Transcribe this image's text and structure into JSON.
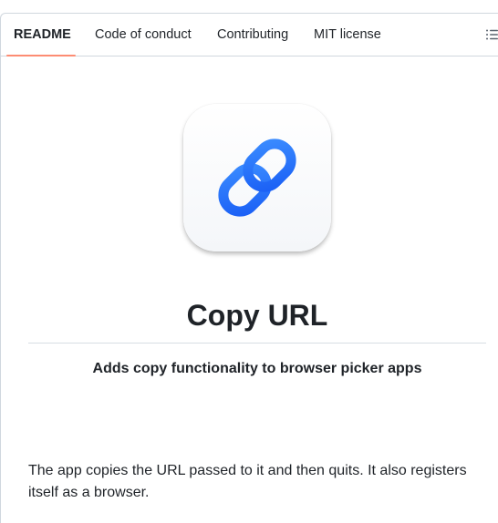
{
  "tabs": [
    {
      "label": "README",
      "active": true
    },
    {
      "label": "Code of conduct",
      "active": false
    },
    {
      "label": "Contributing",
      "active": false
    },
    {
      "label": "MIT license",
      "active": false
    }
  ],
  "outline_icon": "list-unordered-icon",
  "app_icon": "link-chain-icon",
  "colors": {
    "accent_underline": "#fd8c73",
    "link_blue_light": "#3b8cff",
    "link_blue_dark": "#1a5ff5",
    "text": "#1f2328",
    "border": "#d0d7de"
  },
  "readme": {
    "title": "Copy URL",
    "subtitle": "Adds copy functionality to browser picker apps",
    "description": "The app copies the URL passed to it and then quits. It also registers itself as a browser."
  }
}
